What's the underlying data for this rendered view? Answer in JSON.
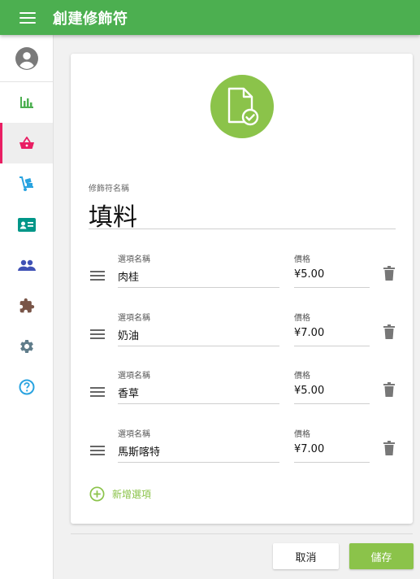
{
  "appbar": {
    "title": "創建修飾符"
  },
  "sidebar": {
    "items": [
      {
        "icon": "bar-chart-icon",
        "color": "#4caf50"
      },
      {
        "icon": "shopping-basket-icon",
        "color": "#e91e63",
        "active": true
      },
      {
        "icon": "hand-truck-icon",
        "color": "#29a3e0"
      },
      {
        "icon": "contact-card-icon",
        "color": "#009688"
      },
      {
        "icon": "people-icon",
        "color": "#3f51b5"
      },
      {
        "icon": "puzzle-icon",
        "color": "#795548"
      },
      {
        "icon": "gear-icon",
        "color": "#607d8b"
      },
      {
        "icon": "help-icon",
        "color": "#29a3e0"
      }
    ]
  },
  "form": {
    "modifier_label": "修飾符名稱",
    "modifier_name": "填料",
    "option_name_label": "選項名稱",
    "price_label": "價格",
    "options": [
      {
        "name": "肉桂",
        "price": "¥5.00"
      },
      {
        "name": "奶油",
        "price": "¥7.00"
      },
      {
        "name": "香草",
        "price": "¥5.00"
      },
      {
        "name": "馬斯喀特",
        "price": "¥7.00"
      }
    ],
    "add_option_label": "新增選項"
  },
  "actions": {
    "cancel": "取消",
    "save": "儲存"
  },
  "colors": {
    "appbar": "#4caf50",
    "accent": "#8bc34a",
    "active_indicator": "#e91e63"
  }
}
